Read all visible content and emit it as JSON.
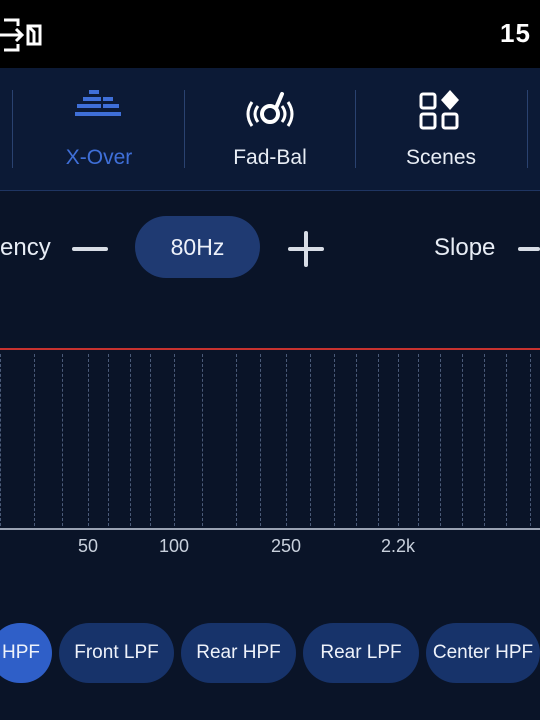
{
  "status": {
    "time": "15"
  },
  "tabs": [
    {
      "label": "X-Over",
      "icon": "equalizer-bars-icon",
      "active": true
    },
    {
      "label": "Fad-Bal",
      "icon": "speaker-balance-icon",
      "active": false
    },
    {
      "label": "Scenes",
      "icon": "scenes-grid-icon",
      "active": false
    }
  ],
  "controls": {
    "frequency_label": "ency",
    "frequency_value": "80Hz",
    "slope_label": "Slope"
  },
  "graph": {
    "x_ticks": [
      "50",
      "100",
      "250",
      "2.2k"
    ]
  },
  "filters": [
    {
      "label": "HPF",
      "active": true
    },
    {
      "label": "Front LPF",
      "active": false
    },
    {
      "label": "Rear HPF",
      "active": false
    },
    {
      "label": "Rear LPF",
      "active": false
    },
    {
      "label": "Center HPF",
      "active": false
    }
  ],
  "colors": {
    "accent": "#3f6fd8",
    "curve": "#c8322f",
    "pill": "#17336a",
    "pill_active": "#2f5fc8"
  }
}
